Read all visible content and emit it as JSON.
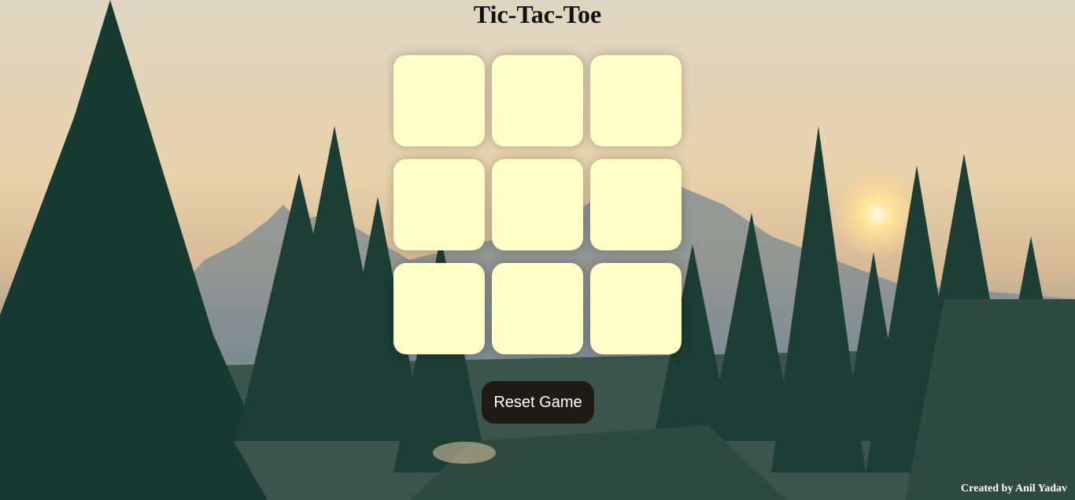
{
  "page": {
    "title": "Tic-Tac-Toe",
    "footer": "Created by Anil Yadav"
  },
  "board": {
    "cells": [
      "",
      "",
      "",
      "",
      "",
      "",
      "",
      "",
      ""
    ]
  },
  "controls": {
    "reset_label": "Reset Game"
  },
  "colors": {
    "cell_bg": "#ffffc8",
    "button_bg": "#1e1a14",
    "button_text": "#ffffff",
    "title_text": "#111111"
  },
  "background": {
    "image": "forest-mountain-sunset"
  }
}
